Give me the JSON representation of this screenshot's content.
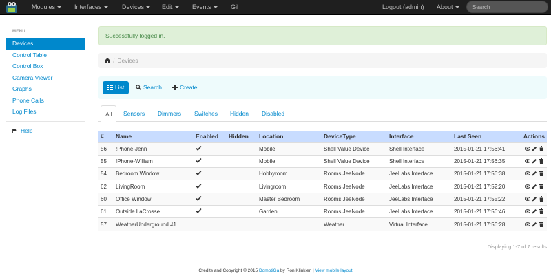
{
  "navbar": {
    "items": [
      {
        "label": "Modules",
        "dropdown": true
      },
      {
        "label": "Interfaces",
        "dropdown": true
      },
      {
        "label": "Devices",
        "dropdown": true
      },
      {
        "label": "Edit",
        "dropdown": true
      },
      {
        "label": "Events",
        "dropdown": true
      },
      {
        "label": "Gil",
        "dropdown": false
      }
    ],
    "logout_label": "Logout (admin)",
    "about_label": "About",
    "search_placeholder": "Search"
  },
  "sidebar": {
    "header": "MENU",
    "items": [
      {
        "label": "Devices",
        "active": true
      },
      {
        "label": "Control Table"
      },
      {
        "label": "Control Box"
      },
      {
        "label": "Camera Viewer"
      },
      {
        "label": "Graphs"
      },
      {
        "label": "Phone Calls"
      },
      {
        "label": "Log Files"
      }
    ],
    "help_label": "Help"
  },
  "alert": {
    "message": "Successfully logged in."
  },
  "breadcrumb": {
    "items": [
      "Devices"
    ]
  },
  "toolbar": {
    "list_label": "List",
    "search_label": "Search",
    "create_label": "Create"
  },
  "tabs": [
    "All",
    "Sensors",
    "Dimmers",
    "Switches",
    "Hidden",
    "Disabled"
  ],
  "table": {
    "columns": [
      "#",
      "Name",
      "Enabled",
      "Hidden",
      "Location",
      "DeviceType",
      "Interface",
      "Last Seen",
      "Actions"
    ],
    "rows": [
      {
        "id": "56",
        "name": "!Phone-Jenn",
        "enabled": true,
        "hidden": false,
        "location": "Mobile",
        "type": "Shell Value Device",
        "interface": "Shell Interface",
        "last_seen": "2015-01-21 17:56:41"
      },
      {
        "id": "55",
        "name": "!Phone-William",
        "enabled": true,
        "hidden": false,
        "location": "Mobile",
        "type": "Shell Value Device",
        "interface": "Shell Interface",
        "last_seen": "2015-01-21 17:56:35"
      },
      {
        "id": "54",
        "name": "Bedroom Window",
        "enabled": true,
        "hidden": false,
        "location": "Hobbyroom",
        "type": "Rooms JeeNode",
        "interface": "JeeLabs Interface",
        "last_seen": "2015-01-21 17:56:38"
      },
      {
        "id": "62",
        "name": "LivingRoom",
        "enabled": true,
        "hidden": false,
        "location": "Livingroom",
        "type": "Rooms JeeNode",
        "interface": "JeeLabs Interface",
        "last_seen": "2015-01-21 17:52:20"
      },
      {
        "id": "60",
        "name": "Office Window",
        "enabled": true,
        "hidden": false,
        "location": "Master Bedroom",
        "type": "Rooms JeeNode",
        "interface": "JeeLabs Interface",
        "last_seen": "2015-01-21 17:55:22"
      },
      {
        "id": "61",
        "name": "Outside LaCrosse",
        "enabled": true,
        "hidden": false,
        "location": "Garden",
        "type": "Rooms JeeNode",
        "interface": "JeeLabs Interface",
        "last_seen": "2015-01-21 17:56:46"
      },
      {
        "id": "57",
        "name": "WeatherUnderground #1",
        "enabled": false,
        "hidden": false,
        "location": "",
        "type": "Weather",
        "interface": "Virtual Interface",
        "last_seen": "2015-01-21 17:56:28"
      }
    ],
    "action_icons": [
      "eye-icon",
      "pencil-icon",
      "trash-icon"
    ]
  },
  "pager": {
    "summary": "Displaying 1-7 of 7 results"
  },
  "footer": {
    "prefix": "Credits and Copyright © 2015",
    "app_link": "DomotiGa",
    "by": "by Ron Klinkien |",
    "mobile_link": "View mobile layout"
  },
  "colors": {
    "navbar": "#1f1f1f",
    "accent": "#0088cc",
    "table_header": "#c8dcff",
    "alert_bg": "#dff0d8",
    "toolbar_bg": "#eefbfc"
  }
}
